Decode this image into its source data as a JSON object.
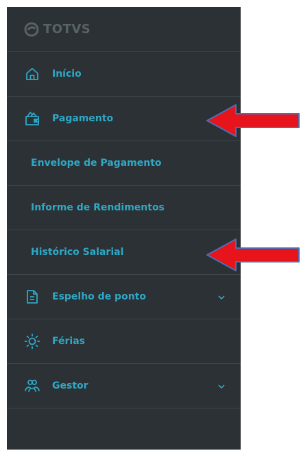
{
  "brand": {
    "name": "TOTVS",
    "logo_icon": "totvs-logo-icon"
  },
  "menu": [
    {
      "label": "Início",
      "icon": "home-icon"
    },
    {
      "label": "Pagamento",
      "icon": "wallet-icon"
    },
    {
      "label": "Envelope de Pagamento"
    },
    {
      "label": "Informe de Rendimentos"
    },
    {
      "label": "Histórico Salarial"
    },
    {
      "label": "Espelho de ponto",
      "icon": "document-icon",
      "expand_icon": "chevron-down-icon"
    },
    {
      "label": "Férias",
      "icon": "sun-icon"
    },
    {
      "label": "Gestor",
      "icon": "group-icon",
      "expand_icon": "chevron-down-icon"
    }
  ],
  "annotations": [
    {
      "icon": "red-arrow-icon",
      "points_to": "Pagamento"
    },
    {
      "icon": "red-arrow-icon",
      "points_to": "Histórico Salarial"
    }
  ],
  "colors": {
    "sidebar_bg": "#2b3134",
    "accent": "#2fa8c6",
    "divider": "#3f474b",
    "arrow": "#e8141c"
  }
}
